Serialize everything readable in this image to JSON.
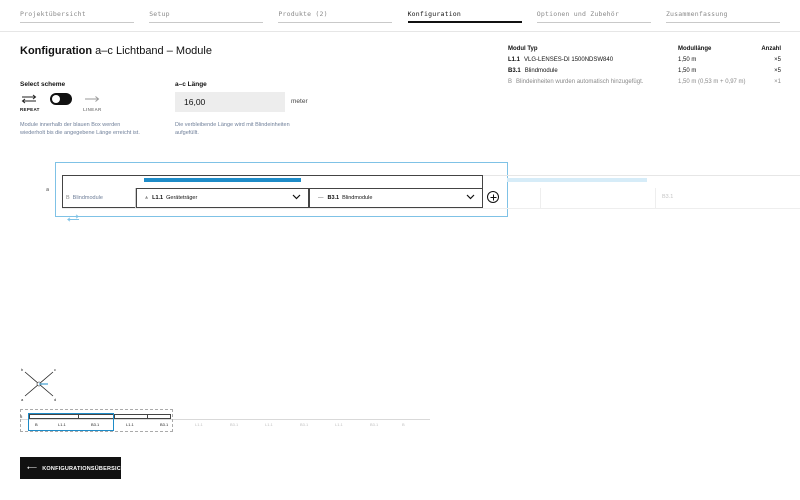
{
  "steps": [
    {
      "label": "Projektübersicht",
      "active": false
    },
    {
      "label": "Setup",
      "active": false
    },
    {
      "label": "Produkte (2)",
      "active": false
    },
    {
      "label": "Konfiguration",
      "active": true
    },
    {
      "label": "Optionen und Zubehör",
      "active": false
    },
    {
      "label": "Zusammenfassung",
      "active": false
    }
  ],
  "title": {
    "bold": "Konfiguration",
    "rest": "a–c Lichtband – Module"
  },
  "module_table": {
    "headers": {
      "type": "Modul Typ",
      "length": "Modullänge",
      "count": "Anzahl"
    },
    "rows": [
      {
        "code": "L1.1",
        "name": "VLG-LENSES-DI 1500NDSW840",
        "length": "1,50 m",
        "count": "×5"
      },
      {
        "code": "B3.1",
        "name": "Blindmodule",
        "length": "1,50 m",
        "count": "×5"
      }
    ],
    "note": {
      "code": "B",
      "text": "Blindeinheiten wurden automatisch hinzugefügt.",
      "length": "1,50 m (0,53 m + 0,97 m)",
      "count": "×1"
    }
  },
  "scheme": {
    "label": "Select scheme",
    "repeat": "REPEAT",
    "linear": "LINEAR",
    "description": "Module innerhalb der blauen Box werden wiederholt bis die angegebene Länge erreicht ist."
  },
  "length": {
    "label": "a–c Länge",
    "value": "16,00",
    "unit": "meter",
    "description": "Die verbleibende Länge wird mit Blindeinheiten aufgefüllt."
  },
  "config_row": {
    "start_label": "a",
    "first": {
      "code": "B",
      "name": "Blindmodule"
    },
    "dropdown1": {
      "code": "L1.1",
      "name": "Geräteträger"
    },
    "dropdown2": {
      "code": "B3.1",
      "name": "Blindmodule"
    },
    "ghost": "B3.1"
  },
  "compass": {
    "b": "b",
    "c": "c",
    "d": "d",
    "a": "a"
  },
  "overview": {
    "start": "a",
    "labels": [
      {
        "text": "B",
        "light": false
      },
      {
        "text": "L1.1",
        "light": false
      },
      {
        "text": "B3.1",
        "light": false
      },
      {
        "text": "L1.1",
        "light": false
      },
      {
        "text": "B3.1",
        "light": false
      },
      {
        "text": "L1.1",
        "light": true
      },
      {
        "text": "B3.1",
        "light": true
      },
      {
        "text": "L1.1",
        "light": true
      },
      {
        "text": "B3.1",
        "light": true
      },
      {
        "text": "L1.1",
        "light": true
      },
      {
        "text": "B3.1",
        "light": true
      },
      {
        "text": "B",
        "light": true
      }
    ]
  },
  "back_button": {
    "label": "KONFIGURATIONSÜBERSICHT"
  },
  "colors": {
    "accent": "#1e8cc8",
    "accent_light": "#d6ecf8",
    "muted_text": "#6f7f99"
  }
}
